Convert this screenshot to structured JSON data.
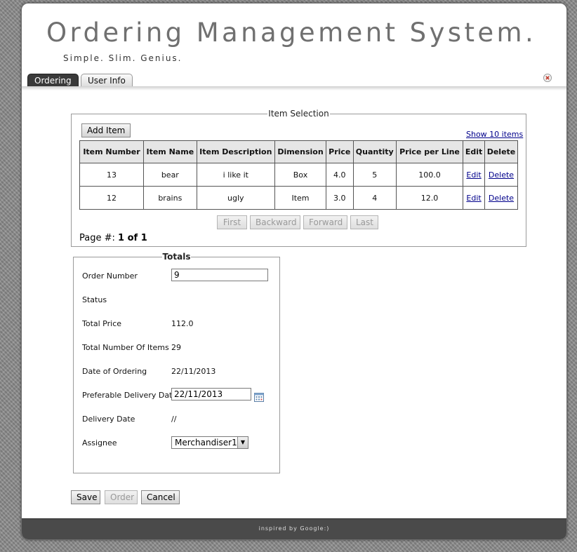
{
  "app": {
    "title": "Ordering Management System.",
    "subtitle": "Simple. Slim. Genius."
  },
  "tabs": [
    {
      "label": "Ordering",
      "active": true
    },
    {
      "label": "User Info",
      "active": false
    }
  ],
  "item_selection": {
    "legend": "Item Selection",
    "add_label": "Add Item",
    "show_link": "Show 10 items",
    "columns": [
      "Item Number",
      "Item Name",
      "Item Description",
      "Dimension",
      "Price",
      "Quantity",
      "Price per Line",
      "Edit",
      "Delete"
    ],
    "rows": [
      {
        "number": "13",
        "name": "bear",
        "description": "i like it",
        "dimension": "Box",
        "price": "4.0",
        "quantity": "5",
        "line_price": "100.0",
        "edit": "Edit",
        "delete": "Delete"
      },
      {
        "number": "12",
        "name": "brains",
        "description": "ugly",
        "dimension": "Item",
        "price": "3.0",
        "quantity": "4",
        "line_price": "12.0",
        "edit": "Edit",
        "delete": "Delete"
      }
    ],
    "pager": {
      "first": "First",
      "backward": "Backward",
      "forward": "Forward",
      "last": "Last",
      "page_label": "Page #:",
      "page_value": "1 of 1"
    }
  },
  "totals": {
    "legend": "Totals",
    "order_number_label": "Order Number",
    "order_number": "9",
    "status_label": "Status",
    "total_price_label": "Total Price",
    "total_price": "112.0",
    "total_items_label": "Total Number Of Items",
    "total_items": "29",
    "date_ordering_label": "Date of Ordering",
    "date_ordering": "22/11/2013",
    "pref_delivery_label": "Preferable Delivery Date",
    "pref_delivery": "22/11/2013",
    "delivery_date_label": "Delivery Date",
    "delivery_date": "//",
    "assignee_label": "Assignee",
    "assignee": "Merchandiser1"
  },
  "actions": {
    "save": "Save",
    "order": "Order",
    "cancel": "Cancel"
  },
  "footer": {
    "text": "inspired by Google:)"
  },
  "colors": {
    "active_tab": "#3a3a3a",
    "footer": "#4a4a4a",
    "link": "#00008b",
    "title": "#707070"
  }
}
